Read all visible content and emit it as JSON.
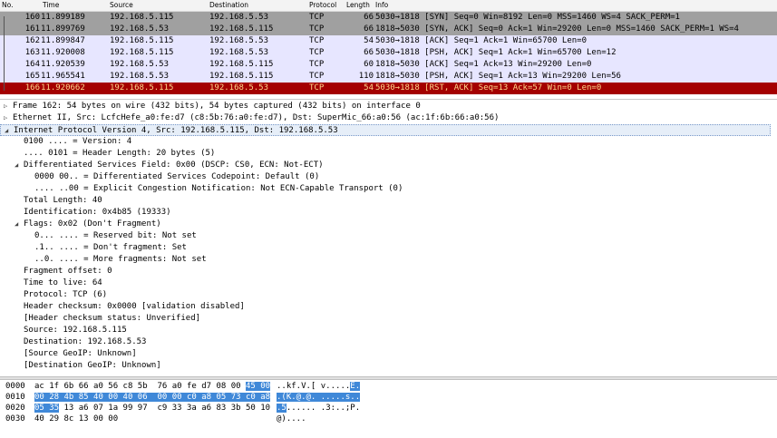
{
  "packet_list": {
    "columns": [
      "No.",
      "Time",
      "Source",
      "Destination",
      "Protocol",
      "Length",
      "Info"
    ],
    "rows": [
      {
        "no": "160",
        "time": "11.899189",
        "src": "192.168.5.115",
        "dst": "192.168.5.53",
        "proto": "TCP",
        "len": "66",
        "info": "5030→1818 [SYN] Seq=0 Win=8192 Len=0 MSS=1460 WS=4 SACK_PERM=1",
        "bg": "#a0a0a0",
        "fg": "#000000"
      },
      {
        "no": "161",
        "time": "11.899769",
        "src": "192.168.5.53",
        "dst": "192.168.5.115",
        "proto": "TCP",
        "len": "66",
        "info": "1818→5030 [SYN, ACK] Seq=0 Ack=1 Win=29200 Len=0 MSS=1460 SACK_PERM=1 WS=4",
        "bg": "#a0a0a0",
        "fg": "#000000"
      },
      {
        "no": "162",
        "time": "11.899847",
        "src": "192.168.5.115",
        "dst": "192.168.5.53",
        "proto": "TCP",
        "len": "54",
        "info": "5030→1818 [ACK] Seq=1 Ack=1 Win=65700 Len=0",
        "bg": "#e7e6ff",
        "fg": "#000000"
      },
      {
        "no": "163",
        "time": "11.920008",
        "src": "192.168.5.115",
        "dst": "192.168.5.53",
        "proto": "TCP",
        "len": "66",
        "info": "5030→1818 [PSH, ACK] Seq=1 Ack=1 Win=65700 Len=12",
        "bg": "#e7e6ff",
        "fg": "#000000"
      },
      {
        "no": "164",
        "time": "11.920539",
        "src": "192.168.5.53",
        "dst": "192.168.5.115",
        "proto": "TCP",
        "len": "60",
        "info": "1818→5030 [ACK] Seq=1 Ack=13 Win=29200 Len=0",
        "bg": "#e7e6ff",
        "fg": "#000000"
      },
      {
        "no": "165",
        "time": "11.965541",
        "src": "192.168.5.53",
        "dst": "192.168.5.115",
        "proto": "TCP",
        "len": "110",
        "info": "1818→5030 [PSH, ACK] Seq=1 Ack=13 Win=29200 Len=56",
        "bg": "#e7e6ff",
        "fg": "#000000"
      },
      {
        "no": "166",
        "time": "11.920662",
        "src": "192.168.5.115",
        "dst": "192.168.5.53",
        "proto": "TCP",
        "len": "54",
        "info": "5030→1818 [RST, ACK] Seq=13 Ack=57 Win=0 Len=0",
        "bg": "#a40000",
        "fg": "#ffd88c"
      }
    ]
  },
  "details": [
    {
      "indent": 0,
      "toggle": "collapsed",
      "text": "Frame 162: 54 bytes on wire (432 bits), 54 bytes captured (432 bits) on interface 0"
    },
    {
      "indent": 0,
      "toggle": "collapsed",
      "text": "Ethernet II, Src: LcfcHefe_a0:fe:d7 (c8:5b:76:a0:fe:d7), Dst: SuperMic_66:a0:56 (ac:1f:6b:66:a0:56)"
    },
    {
      "indent": 0,
      "toggle": "expanded",
      "text": "Internet Protocol Version 4, Src: 192.168.5.115, Dst: 192.168.5.53",
      "selected": true
    },
    {
      "indent": 1,
      "toggle": "none",
      "text": "0100 .... = Version: 4"
    },
    {
      "indent": 1,
      "toggle": "none",
      "text": ".... 0101 = Header Length: 20 bytes (5)"
    },
    {
      "indent": 1,
      "toggle": "expanded",
      "text": "Differentiated Services Field: 0x00 (DSCP: CS0, ECN: Not-ECT)"
    },
    {
      "indent": 2,
      "toggle": "none",
      "text": "0000 00.. = Differentiated Services Codepoint: Default (0)"
    },
    {
      "indent": 2,
      "toggle": "none",
      "text": ".... ..00 = Explicit Congestion Notification: Not ECN-Capable Transport (0)"
    },
    {
      "indent": 1,
      "toggle": "none",
      "text": "Total Length: 40"
    },
    {
      "indent": 1,
      "toggle": "none",
      "text": "Identification: 0x4b85 (19333)"
    },
    {
      "indent": 1,
      "toggle": "expanded",
      "text": "Flags: 0x02 (Don't Fragment)"
    },
    {
      "indent": 2,
      "toggle": "none",
      "text": "0... .... = Reserved bit: Not set"
    },
    {
      "indent": 2,
      "toggle": "none",
      "text": ".1.. .... = Don't fragment: Set"
    },
    {
      "indent": 2,
      "toggle": "none",
      "text": "..0. .... = More fragments: Not set"
    },
    {
      "indent": 1,
      "toggle": "none",
      "text": "Fragment offset: 0"
    },
    {
      "indent": 1,
      "toggle": "none",
      "text": "Time to live: 64"
    },
    {
      "indent": 1,
      "toggle": "none",
      "text": "Protocol: TCP (6)"
    },
    {
      "indent": 1,
      "toggle": "none",
      "text": "Header checksum: 0x0000 [validation disabled]"
    },
    {
      "indent": 1,
      "toggle": "none",
      "text": "[Header checksum status: Unverified]"
    },
    {
      "indent": 1,
      "toggle": "none",
      "text": "Source: 192.168.5.115"
    },
    {
      "indent": 1,
      "toggle": "none",
      "text": "Destination: 192.168.5.53"
    },
    {
      "indent": 1,
      "toggle": "none",
      "text": "[Source GeoIP: Unknown]"
    },
    {
      "indent": 1,
      "toggle": "none",
      "text": "[Destination GeoIP: Unknown]"
    }
  ],
  "bytes": [
    {
      "offset": "0000",
      "hex_pre": "ac 1f 6b 66 a0 56 c8 5b  76 a0 fe d7 08 00 ",
      "hex_hl": "45 00",
      "hex_post": "",
      "ascii_pre": "..kf.V.[ v.....",
      "ascii_hl": "E.",
      "ascii_post": ""
    },
    {
      "offset": "0010",
      "hex_pre": "",
      "hex_hl": "00 28 4b 85 40 00 40 06  00 00 c0 a8 05 73 c0 a8",
      "hex_post": "",
      "ascii_pre": "",
      "ascii_hl": ".(K.@.@. .....s..",
      "ascii_post": ""
    },
    {
      "offset": "0020",
      "hex_pre": "",
      "hex_hl": "05 35",
      "hex_post": " 13 a6 07 1a 99 97  c9 33 3a a6 83 3b 50 10",
      "ascii_pre": "",
      "ascii_hl": ".5",
      "ascii_post": "...... .3:..;P."
    },
    {
      "offset": "0030",
      "hex_pre": "40 29 8c 13 00 00",
      "hex_hl": "",
      "hex_post": "",
      "ascii_pre": "@)....",
      "ascii_hl": "",
      "ascii_post": ""
    }
  ],
  "colors": {
    "selected_detail_bg": "#e6eef8",
    "byte_highlight": "#3f88d8",
    "rst_row_bg": "#a40000",
    "rst_row_fg": "#ffd88c"
  }
}
